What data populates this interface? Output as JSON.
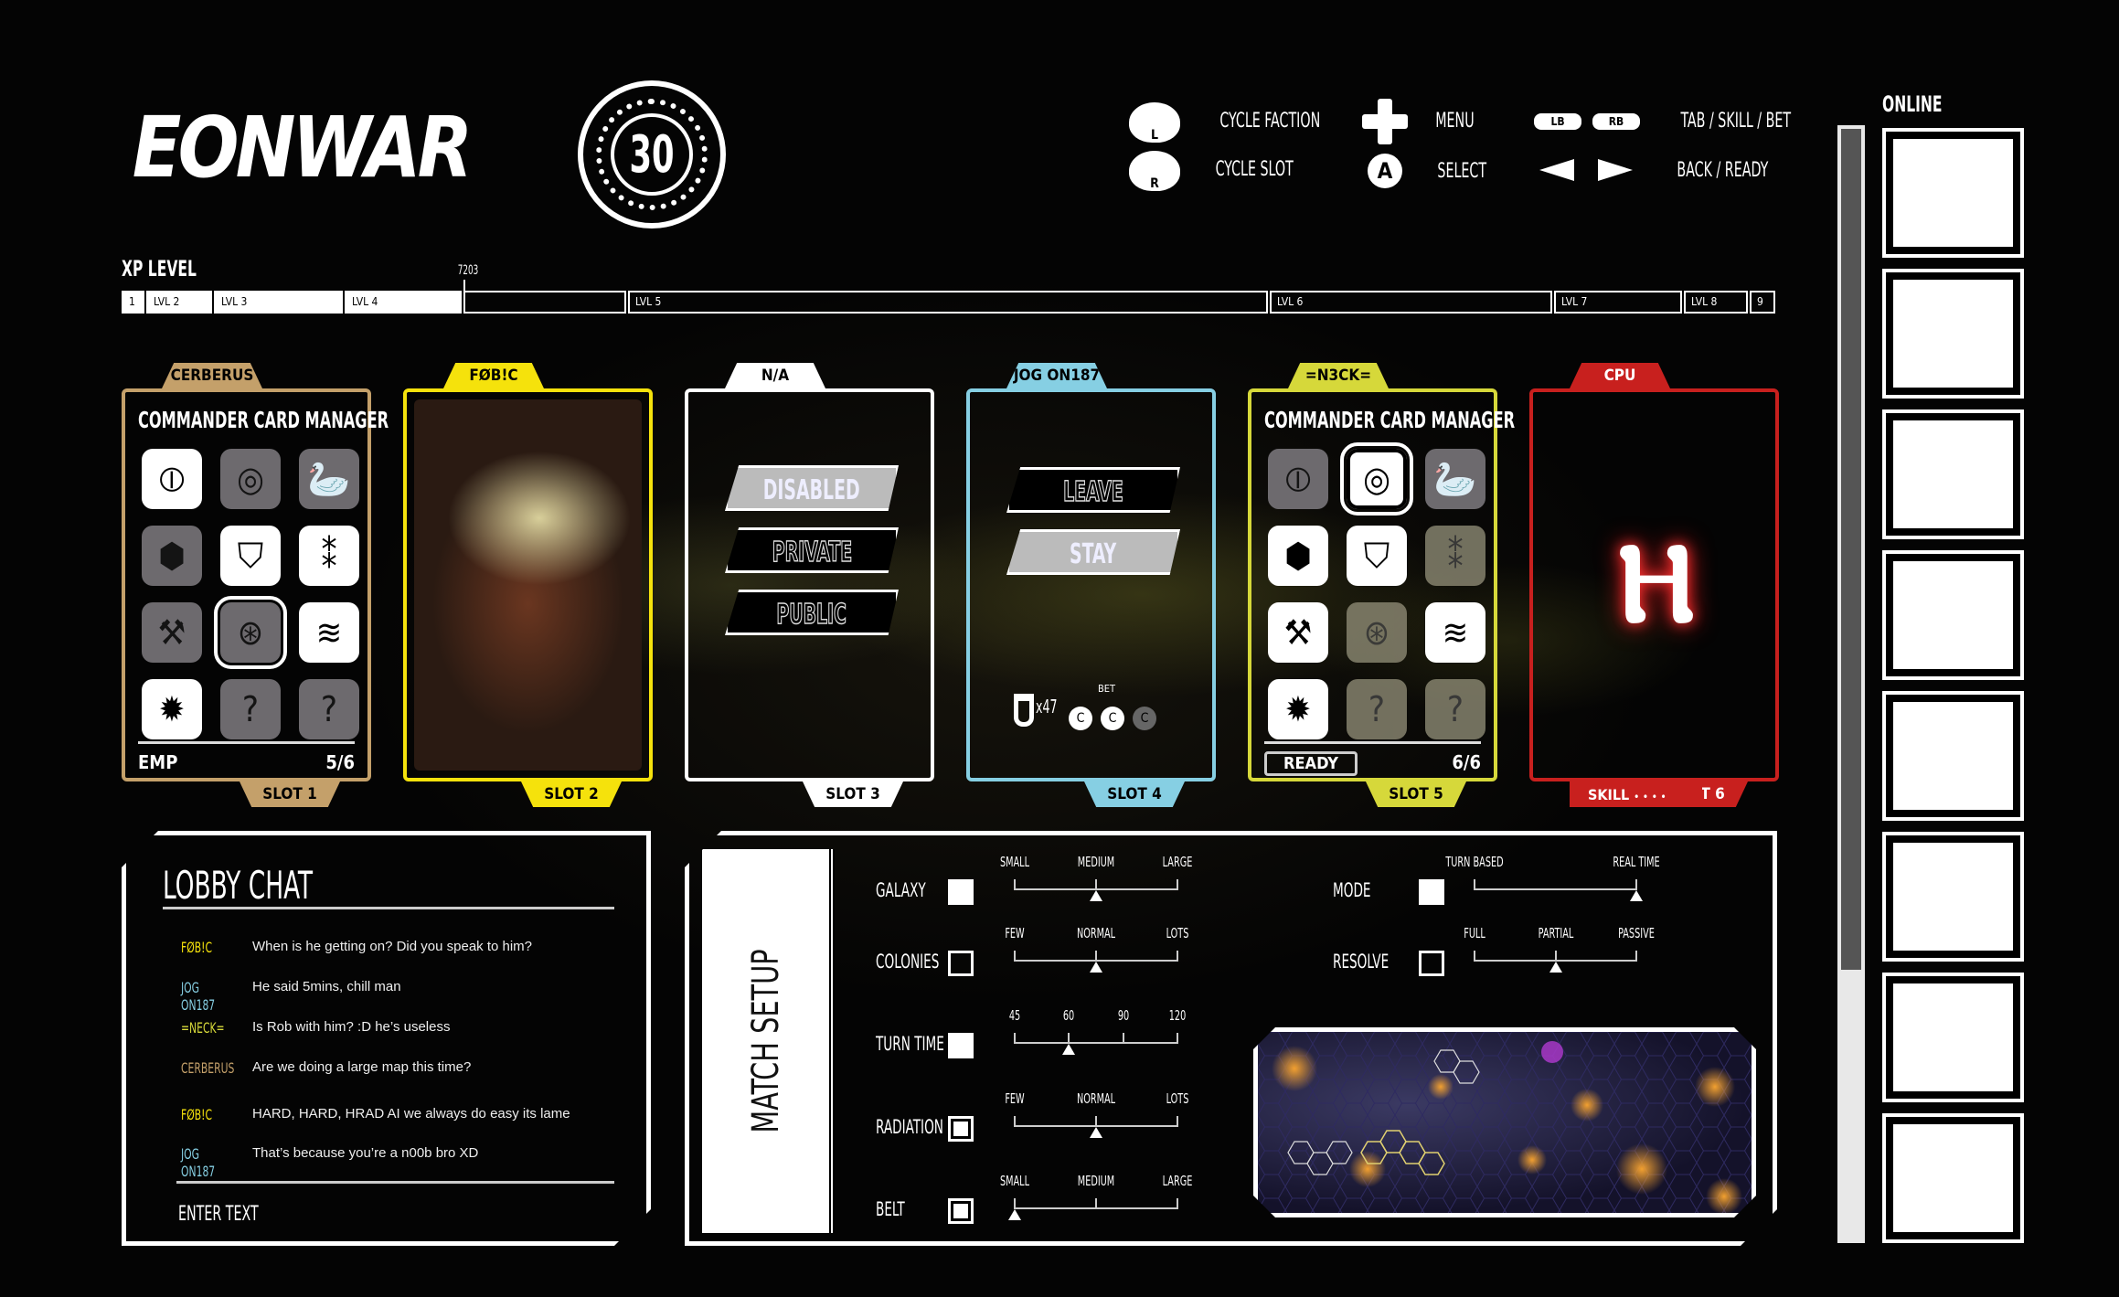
{
  "logo": "EONWAR",
  "timer": "30",
  "controls": [
    {
      "icon": "left-stick-icon",
      "key": "L",
      "label": "CYCLE FACTION"
    },
    {
      "icon": "right-stick-icon",
      "key": "R",
      "label": "CYCLE SLOT"
    },
    {
      "icon": "dpad-icon",
      "label": "MENU"
    },
    {
      "icon": "a-button-icon",
      "key": "A",
      "label": "SELECT"
    },
    {
      "icon": "bumpers-icon",
      "keys": [
        "LB",
        "RB"
      ],
      "label": "TAB / SKILL / BET"
    },
    {
      "icon": "left-right-arrows-icon",
      "label": "BACK / READY"
    }
  ],
  "xp": {
    "label": "XP LEVEL",
    "value": "7203",
    "progress_level": "LVL 5",
    "levels": [
      "1",
      "LVL 2",
      "LVL 3",
      "LVL 4",
      "",
      "LVL 5",
      "LVL 6",
      "LVL 7",
      "LVL 8",
      "9"
    ]
  },
  "slots": [
    {
      "player": "CERBERUS",
      "slot": "SLOT 1",
      "color": "#c4a06a",
      "type": "manager",
      "title": "COMMANDER CARD MANAGER",
      "footer_left": "EMP",
      "footer_right": "5/6",
      "tiles": [
        [
          "portal-icon",
          "on"
        ],
        [
          "radar-icon",
          "off"
        ],
        [
          "bird-icon",
          "off"
        ],
        [
          "hex-map-icon",
          "off"
        ],
        [
          "shield-icon",
          "on"
        ],
        [
          "ammo-x2-icon",
          "on"
        ],
        [
          "tools-icon",
          "off"
        ],
        [
          "cracked-orb-icon",
          "sel"
        ],
        [
          "storm-icon",
          "on"
        ],
        [
          "emp-burst-icon",
          "on"
        ],
        [
          "unknown-icon",
          "off"
        ],
        [
          "unknown-icon",
          "off"
        ]
      ]
    },
    {
      "player": "FØB!C",
      "slot": "SLOT 2",
      "color": "#f5e20c",
      "type": "portrait"
    },
    {
      "player": "N/A",
      "slot": "SLOT 3",
      "color": "#ffffff",
      "type": "options",
      "options": [
        "DISABLED",
        "PRIVATE",
        "PUBLIC"
      ]
    },
    {
      "player": "JOG ON187",
      "slot": "SLOT 4",
      "color": "#86cfe3",
      "type": "leave",
      "options": [
        "LEAVE",
        "STAY"
      ],
      "credits": "x47",
      "bet_label": "BET"
    },
    {
      "player": "=N3CK=",
      "slot": "SLOT 5",
      "color": "#d6d83a",
      "type": "manager",
      "title": "COMMANDER CARD MANAGER",
      "footer_left": "READY",
      "footer_right": "6/6",
      "tiles": [
        [
          "portal-icon",
          "off"
        ],
        [
          "radar-icon",
          "selw"
        ],
        [
          "bird-icon",
          "off"
        ],
        [
          "hex-map-icon",
          "on"
        ],
        [
          "shield-icon",
          "on"
        ],
        [
          "ammo-x2-icon",
          "fade"
        ],
        [
          "tools-icon",
          "on"
        ],
        [
          "cracked-orb-icon",
          "fade"
        ],
        [
          "storm-icon",
          "on"
        ],
        [
          "emp-burst-icon",
          "on"
        ],
        [
          "unknown-icon",
          "fade"
        ],
        [
          "unknown-icon",
          "fade"
        ]
      ]
    },
    {
      "player": "CPU",
      "slot": "SLOT 6",
      "color": "#c8201e",
      "type": "cpu",
      "skill": "SKILL",
      "skill_dots": "• • • •"
    }
  ],
  "chat": {
    "title": "LOBBY CHAT",
    "input_placeholder": "ENTER TEXT",
    "messages": [
      {
        "name": "FØB!C",
        "color": "#f5e20c",
        "text": "When is he getting on? Did you speak to him?"
      },
      {
        "name": "JOG ON187",
        "color": "#86cfe3",
        "text": "He said 5mins, chill man"
      },
      {
        "name": "=NECK=",
        "color": "#d6d83a",
        "text": "Is Rob with him? :D he’s useless"
      },
      {
        "name": "CERBERUS",
        "color": "#c4a06a",
        "text": "Are we doing a large map this time?"
      },
      {
        "name": "FØB!C",
        "color": "#f5e20c",
        "text": "HARD, HARD, HRAD AI we always do easy its lame"
      },
      {
        "name": "JOG ON187",
        "color": "#86cfe3",
        "text": "That’s because you’re a n00b bro XD"
      }
    ]
  },
  "match": {
    "title": "MATCH SETUP",
    "settings": [
      {
        "label": "GALAXY",
        "checkbox": "filled",
        "options": [
          "SMALL",
          "MEDIUM",
          "LARGE"
        ],
        "selected": 1
      },
      {
        "label": "COLONIES",
        "checkbox": "empty",
        "options": [
          "FEW",
          "NORMAL",
          "LOTS"
        ],
        "selected": 1
      },
      {
        "label": "TURN TIME",
        "checkbox": "filled",
        "options": [
          "45",
          "60",
          "90",
          "120"
        ],
        "selected": 1
      },
      {
        "label": "RADIATION",
        "checkbox": "framed",
        "options": [
          "FEW",
          "NORMAL",
          "LOTS"
        ],
        "selected": 1
      },
      {
        "label": "BELT",
        "checkbox": "framed",
        "options": [
          "SMALL",
          "MEDIUM",
          "LARGE"
        ],
        "selected": 0
      },
      {
        "label": "MODE",
        "checkbox": "filled",
        "options": [
          "TURN BASED",
          "REAL TIME"
        ],
        "selected": 1
      },
      {
        "label": "RESOLVE",
        "checkbox": "empty",
        "options": [
          "FULL",
          "PARTIAL",
          "PASSIVE"
        ],
        "selected": 1
      }
    ]
  },
  "online": {
    "label": "ONLINE",
    "slots": 8
  }
}
